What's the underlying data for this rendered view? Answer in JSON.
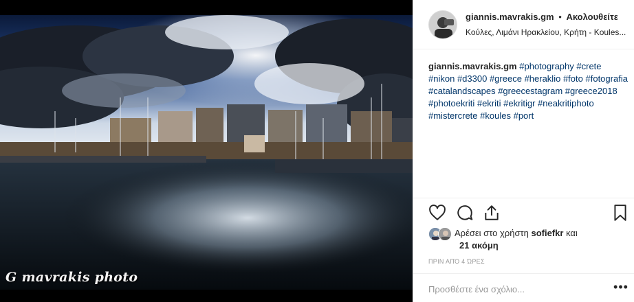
{
  "post": {
    "author": "giannis.mavrakis.gm",
    "separator": "•",
    "follow_label": "Ακολουθείτε",
    "location": "Κούλες, Λιμάνι Ηρακλείου, Κρήτη - Koules...",
    "photo_watermark": "G mavrakis photo"
  },
  "caption": {
    "user": "giannis.mavrakis.gm",
    "hashtags": [
      "#photography",
      "#crete",
      "#nikon",
      "#d3300",
      "#greece",
      "#heraklio",
      "#foto",
      "#fotografia",
      "#catalandscapes",
      "#greecestagram",
      "#greece2018",
      "#photoekriti",
      "#ekriti",
      "#ekritigr",
      "#neakritiphoto",
      "#mistercrete",
      "#koules",
      "#port"
    ]
  },
  "actions": {
    "like_icon": "heart-icon",
    "comment_icon": "comment-icon",
    "share_icon": "share-icon",
    "save_icon": "bookmark-icon"
  },
  "likes": {
    "prefix": "Αρέσει στο χρήστη",
    "user": "sofiefkr",
    "conjunction": "και",
    "others": "21 ακόμη"
  },
  "timestamp": "ΠΡΙΝ ΑΠΌ 4 ΏΡΕΣ",
  "comment": {
    "placeholder": "Προσθέστε ένα σχόλιο...",
    "more_label": "•••"
  },
  "colors": {
    "hashtag": "#003569",
    "text": "#262626",
    "muted": "#999999",
    "divider": "#efefef"
  }
}
